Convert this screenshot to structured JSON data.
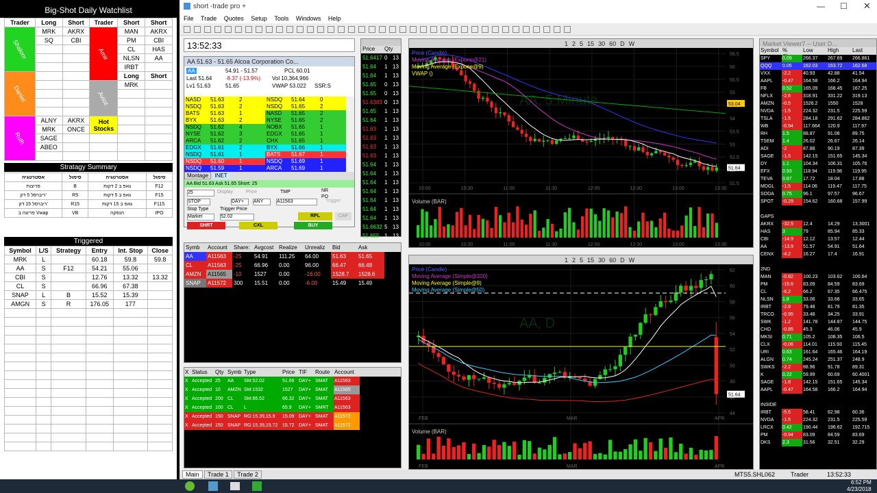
{
  "watchlist": {
    "title": "Big-Shot Daily Watchlist",
    "headers": [
      "Trader",
      "Long",
      "Short",
      "Trader",
      "Short",
      "Short"
    ],
    "left_names": [
      "Shalom",
      "Daniel",
      "Ruth"
    ],
    "right_names": [
      "Amir",
      "Avioz"
    ],
    "shalom": [
      [
        "MRK",
        "AKRX"
      ],
      [
        "SQ",
        "CBI"
      ]
    ],
    "amir": [
      [
        "MAN",
        "AKRX"
      ],
      [
        "PM",
        "CBI"
      ],
      [
        "CL",
        "HAS"
      ],
      [
        "NLSN",
        "AA"
      ],
      [
        "IRBT",
        ""
      ]
    ],
    "avioz_head": [
      "Long",
      "Short"
    ],
    "avioz": [
      [
        "MRK",
        ""
      ]
    ],
    "ruth": [
      [
        "ALNY",
        "AKRX"
      ],
      [
        "MRK",
        "ONCE"
      ],
      [
        "SAGE",
        ""
      ],
      [
        "ABEO",
        ""
      ]
    ],
    "hot": "Hot Stocks",
    "strategy_title": "Stratagy Summary",
    "strategy_headers": [
      "אסטרטגיה",
      "סימול",
      "אסטרטגיה",
      "סימול"
    ],
    "strategies": [
      [
        "פריצות",
        "B",
        "גאפ ב 2 דקות",
        "F12"
      ],
      [
        "ריברסל 5 דק'",
        "R5",
        "גאפ ב 5 דקות",
        "F15"
      ],
      [
        "ריברסל 15 דק'",
        "R15",
        "גאפ ב 15 דקות",
        "F115"
      ],
      [
        "פריצה ב Vwap",
        "VB",
        "הנפקה",
        "IPO"
      ]
    ],
    "triggered_title": "Triggered",
    "trig_headers": [
      "Symbol",
      "L/S",
      "Strategy",
      "Entry",
      "Int. Stop",
      "Close"
    ],
    "triggered": [
      [
        "MRK",
        "L",
        "",
        "60.18",
        "59.8",
        "59.8"
      ],
      [
        "AA",
        "S",
        "F12",
        "54.21",
        "55.06",
        ""
      ],
      [
        "CBI",
        "S",
        "",
        "12.76",
        "13.32",
        "13.32"
      ],
      [
        "CL",
        "S",
        "",
        "66.96",
        "67.38",
        ""
      ],
      [
        "SNAP",
        "L",
        "B",
        "15.52",
        "15.39",
        ""
      ],
      [
        "AMGN",
        "S",
        "R",
        "176.05",
        "177",
        ""
      ]
    ]
  },
  "app": {
    "title": "short -trade pro +",
    "menu": [
      "File",
      "Trade",
      "Quotes",
      "Setup",
      "Tools",
      "Windows",
      "Help"
    ],
    "clock": "13:52:33",
    "taskbar": [
      "Main",
      "Trade 1",
      "Trade 2"
    ],
    "status_user": "Trader",
    "status_time": "13:52:33",
    "status_sym": "MTS5.SHL062",
    "sys_time": "6:52 PM",
    "sys_date": "4/23/2018"
  },
  "level2": {
    "title": "AA  51.63 - 51.65  Alcoa Corporation Co...",
    "sym": "AA",
    "bidask": "54.91 - 51.57",
    "pcl": "PCL 60.01",
    "last": "Last 51.64",
    "chg": "-8.37 (-13.9%)",
    "vol": "Vol 10,364,966",
    "lv1": "Lv1 51.63",
    "lv1b": "51.65",
    "vwap": "VWAP 53.022",
    "ssr": "SSR:S",
    "bids": [
      [
        "NASD",
        "51.63",
        "2"
      ],
      [
        "NSDQ",
        "51.63",
        "2"
      ],
      [
        "BATS",
        "51.63",
        "1"
      ],
      [
        "BYX",
        "51.63",
        "2"
      ],
      [
        "NSDQ",
        "51.62",
        "4"
      ],
      [
        "NYSE",
        "51.62",
        "3"
      ],
      [
        "ARCA",
        "51.62",
        "2"
      ],
      [
        "EDGX",
        "51.61",
        "2"
      ],
      [
        "NSDQ",
        "51.61",
        "1"
      ],
      [
        "NSDQ",
        "51.60",
        "1"
      ],
      [
        "NSDQ",
        "51.59",
        "1"
      ]
    ],
    "asks": [
      [
        "NSDQ",
        "51.64",
        "0"
      ],
      [
        "NSDQ",
        "51.65",
        "2"
      ],
      [
        "NASD",
        "51.65",
        "2"
      ],
      [
        "NYSE",
        "51.65",
        "2"
      ],
      [
        "NOBX",
        "51.65",
        "1"
      ],
      [
        "EDGX",
        "51.65",
        "1"
      ],
      [
        "CHX",
        "51.65",
        "1"
      ],
      [
        "BYX",
        "51.66",
        "1"
      ],
      [
        "BATS",
        "51.67",
        "1"
      ],
      [
        "NSDQ",
        "51.69",
        "1"
      ],
      [
        "ARCA",
        "51.69",
        "1"
      ]
    ],
    "tabs": [
      "Montage",
      "INET"
    ],
    "footer": "AA Bid 51.63 Ask 51.65   Short: 25",
    "qty": "25",
    "order_type": "STOP",
    "tif": "DAY+",
    "route": "ANY",
    "account": "A11563",
    "display": "Display",
    "price": "Price",
    "tmp": "TMP",
    "nr": "NR",
    "po": "PO",
    "trigger": "Trigger",
    "stop_type": "Stop Type",
    "trigger_price": "Trigger Price",
    "market": "Market",
    "tprice": "52.02",
    "shrt": "SHRT",
    "cxl": "CXL",
    "buy": "BUY",
    "rpl": "RPL",
    "cap": "CAP"
  },
  "tns": {
    "headers": [
      "Price",
      "Qty"
    ],
    "rows": [
      [
        "51.6417",
        "0"
      ],
      [
        "51.64",
        "1"
      ],
      [
        "51.64",
        "1"
      ],
      [
        "51.65",
        "0"
      ],
      [
        "51.65",
        "0"
      ],
      [
        "51.6383",
        "0"
      ],
      [
        "51.65",
        "1"
      ],
      [
        "51.64",
        "1"
      ],
      [
        "51.63",
        "1"
      ],
      [
        "51.63",
        "1"
      ],
      [
        "51.63",
        "1"
      ],
      [
        "51.63",
        "1"
      ],
      [
        "51.64",
        "1"
      ],
      [
        "51.64",
        "1"
      ],
      [
        "51.64",
        "1"
      ],
      [
        "51.64",
        "1"
      ],
      [
        "51.64",
        "1"
      ],
      [
        "51.64",
        "1"
      ],
      [
        "51.64",
        "1"
      ],
      [
        "51.6632",
        "5"
      ],
      [
        "51.655",
        "1"
      ]
    ],
    "qtyx": "13"
  },
  "positions": {
    "headers": [
      "Symb",
      "Account",
      "Share:",
      "Avgcost",
      "Realize",
      "Unrealiz",
      "Bid",
      "Ask"
    ],
    "rows": [
      [
        "AA",
        "A11563",
        "-25",
        "54.91",
        "111.25",
        "64.00",
        "51.63",
        "51.65"
      ],
      [
        "CL",
        "A11563",
        "-25",
        "66.96",
        "0.00",
        "96.00",
        "66.47",
        "66.48"
      ],
      [
        "AMZN",
        "A11565",
        "-10",
        "1527",
        "0.00",
        "-16.00",
        "1528.7",
        "1528.6"
      ],
      [
        "SNAP",
        "A11572",
        "300",
        "15.51",
        "0.00",
        "-6.00",
        "15.49",
        "15.49"
      ]
    ]
  },
  "orders": {
    "headers": [
      "X",
      "Status",
      "Qty",
      "Symb",
      "Type",
      "Price",
      "TIF",
      "Route",
      "Account"
    ],
    "rows": [
      [
        "X",
        "Accepted",
        "25",
        "AA",
        "SM:52.02",
        "51.66",
        "DAY+",
        "SMAT",
        "A11563"
      ],
      [
        "X",
        "Accepted",
        "10",
        "AMZN",
        "SM:1532",
        "1527",
        "DAY+",
        "SMAT",
        "A11565"
      ],
      [
        "X",
        "Accepted",
        "200",
        "CL",
        "SM:66.52",
        "66.32",
        "DAY+",
        "SMAT",
        "A11563"
      ],
      [
        "X",
        "Accepted",
        "100",
        "CL",
        "L",
        "65.9",
        "DAY+",
        "SMRT",
        "A11563"
      ],
      [
        "X",
        "Accepted",
        "150",
        "SNAP",
        "RG:15.39,15.9",
        "15.09",
        "DAY+",
        "SMAT",
        "A11572"
      ],
      [
        "X",
        "Accepted",
        "150",
        "SNAP",
        "RG:15.39,15.72",
        "15.72",
        "DAY+",
        "SMAT",
        "A11572"
      ]
    ]
  },
  "chart1": {
    "legend": [
      "Price (Candle)",
      "Moving Average (Expone@21)",
      "Moving Average (Expone@9)",
      "VWAP ()"
    ],
    "watermark": "AA, 5 Minute",
    "volume_label": "Volume (BAR)",
    "price_tag": "51.64",
    "vwap_tag": "53.04",
    "xticks": [
      "10:00",
      "10:30",
      "11:00",
      "11:30",
      "12:00",
      "12:30",
      "13:00",
      "13:30"
    ],
    "yticks": [
      "56.5",
      "56",
      "55.5",
      "55",
      "54.5",
      "54",
      "53.5",
      "53",
      "52.5",
      "52",
      "51.5"
    ],
    "tf": [
      "1",
      "2",
      "5",
      "15",
      "30",
      "60",
      "D",
      "W"
    ]
  },
  "chart2": {
    "legend": [
      "Price (Candle)",
      "Moving Average (Simple@200)",
      "Moving Average (Simple@9)",
      "Moving Average (Simple@50)"
    ],
    "watermark": "AA, D",
    "volume_label": "Volume (BAR)",
    "price_tag": "51.64",
    "xticks": [
      "FEB",
      "MAR",
      "APR"
    ],
    "yticks": [
      "62",
      "60",
      "58",
      "56",
      "54",
      "52",
      "50",
      "48",
      "46",
      "44"
    ],
    "tf": [
      "1",
      "2",
      "5",
      "15",
      "30",
      "60",
      "D",
      "W"
    ]
  },
  "viewer": {
    "title": "Market Viewer7 -- User D...",
    "headers": [
      "Symbol",
      "% Cha...",
      "Low",
      "High",
      "Last"
    ],
    "rows": [
      [
        "SPY",
        "0.09",
        "266.37",
        "267.69",
        "266.861",
        "g"
      ],
      [
        "QQQ",
        "0.05",
        "162.03",
        "163.72",
        "162.68",
        "s"
      ],
      [
        "VXX",
        "-2.2",
        "40.93",
        "42.88",
        "41.54",
        "r"
      ],
      [
        "AAPL",
        "-0.47",
        "164.58",
        "166.2",
        "164.94",
        "r"
      ],
      [
        "FB",
        "0.52",
        "165.09",
        "168.45",
        "167.25",
        "g"
      ],
      [
        "NFLX",
        "-2.6",
        "318.91",
        "331.22",
        "319.13",
        "r"
      ],
      [
        "AMZN",
        "-0.5",
        "1526.2",
        "1550",
        "1528",
        "r"
      ],
      [
        "NVDA",
        "-1.5",
        "224.32",
        "231.5",
        "225.59",
        "r"
      ],
      [
        "TSLA",
        "-1.5",
        "284.18",
        "291.62",
        "284.862",
        "r"
      ],
      [
        "WB",
        "-0.94",
        "117.664",
        "120.9",
        "117.97",
        "r"
      ],
      [
        "RH",
        "1.5",
        "88.87",
        "91.08",
        "89.75",
        "g"
      ],
      [
        "TSEM",
        "1.4",
        "26.02",
        "26.67",
        "26.14",
        "g"
      ],
      [
        "ADI",
        "-2",
        "87.88",
        "90.19",
        "87.39",
        "r"
      ],
      [
        "SAGE",
        "-1.5",
        "142.15",
        "151.65",
        "145.34",
        "r"
      ],
      [
        "DY",
        "1.1",
        "104.34",
        "106.31",
        "105.76",
        "g"
      ],
      [
        "EFX",
        "0.93",
        "118.94",
        "119.98",
        "119.95",
        "g"
      ],
      [
        "TEVA",
        "0.87",
        "17.72",
        "18.04",
        "17.88",
        "g"
      ],
      [
        "MDGL",
        "-1.5",
        "114.06",
        "119.47",
        "117.75",
        "r"
      ],
      [
        "SODA",
        "0.75",
        "96.1",
        "97.57",
        "96.67",
        "g"
      ],
      [
        "SPOT",
        "-0.29",
        "154.62",
        "160.68",
        "157.99",
        "r"
      ],
      [
        "",
        "",
        "",
        "",
        "",
        ""
      ],
      [
        "GAPS",
        "",
        "",
        "",
        "",
        ""
      ],
      [
        "AKRX",
        "-32.5",
        "12.4",
        "14.29",
        "13.3001",
        "r"
      ],
      [
        "HAS",
        "3",
        "79",
        "85.94",
        "85.33",
        "g"
      ],
      [
        "CBI",
        "-14.9",
        "12.12",
        "13.57",
        "12.44",
        "r"
      ],
      [
        "AA",
        "-13.9",
        "51.57",
        "54.91",
        "51.64",
        "r"
      ],
      [
        "CENX",
        "-4.2",
        "16.27",
        "17.4",
        "16.91",
        "r"
      ],
      [
        "",
        "",
        "",
        "",
        "",
        ""
      ],
      [
        "2ND",
        "",
        "",
        "",
        "",
        ""
      ],
      [
        "MAN",
        "-0.82",
        "100.23",
        "103.62",
        "100.64",
        "r"
      ],
      [
        "PM",
        "-15.6",
        "83.09",
        "84.59",
        "83.69",
        "r"
      ],
      [
        "CL",
        "-6.2",
        "66.2",
        "67.35",
        "66.475",
        "r"
      ],
      [
        "NLSN",
        "1.8",
        "33.06",
        "33.68",
        "33.65",
        "g"
      ],
      [
        "IRBT",
        "-2.8",
        "79.48",
        "81.79",
        "81.35",
        "r"
      ],
      [
        "TRCO",
        "-0.95",
        "33.48",
        "34.25",
        "33.91",
        "r"
      ],
      [
        "SWK",
        "-1.2",
        "141.78",
        "144.87",
        "144.75",
        "r"
      ],
      [
        "CHD",
        "-0.85",
        "45.3",
        "46.06",
        "45.9",
        "r"
      ],
      [
        "MKSI",
        "0.71",
        "105.2",
        "108.35",
        "106.5",
        "g"
      ],
      [
        "CLX",
        "-0.06",
        "114.01",
        "115.93",
        "115.45",
        "r"
      ],
      [
        "URI",
        "0.63",
        "161.64",
        "165.46",
        "164.19",
        "g"
      ],
      [
        "ALGN",
        "0.74",
        "245.24",
        "251.37",
        "248.9",
        "g"
      ],
      [
        "SWKS",
        "-2.2",
        "88.96",
        "91.78",
        "89.31",
        "r"
      ],
      [
        "K",
        "0.22",
        "59.99",
        "60.69",
        "60.4001",
        "g"
      ],
      [
        "SAGE",
        "-1.8",
        "142.15",
        "151.65",
        "145.34",
        "r"
      ],
      [
        "AAPL",
        "-0.47",
        "164.58",
        "166.2",
        "164.94",
        "r"
      ],
      [
        "",
        "",
        "",
        "",
        "",
        ""
      ],
      [
        "INSIDE",
        "",
        "",
        "",
        "",
        ""
      ],
      [
        "IRBT",
        "-5.5",
        "58.41",
        "62.98",
        "60.36",
        "r"
      ],
      [
        "NVDA",
        "-1.5",
        "224.32",
        "231.5",
        "225.59",
        "r"
      ],
      [
        "LRCX",
        "0.42",
        "190.44",
        "196.62",
        "192.715",
        "g"
      ],
      [
        "PM",
        "-0.94",
        "83.09",
        "84.59",
        "83.69",
        "r"
      ],
      [
        "DKS",
        "2.3",
        "31.56",
        "32.51",
        "32.29",
        "g"
      ]
    ]
  }
}
